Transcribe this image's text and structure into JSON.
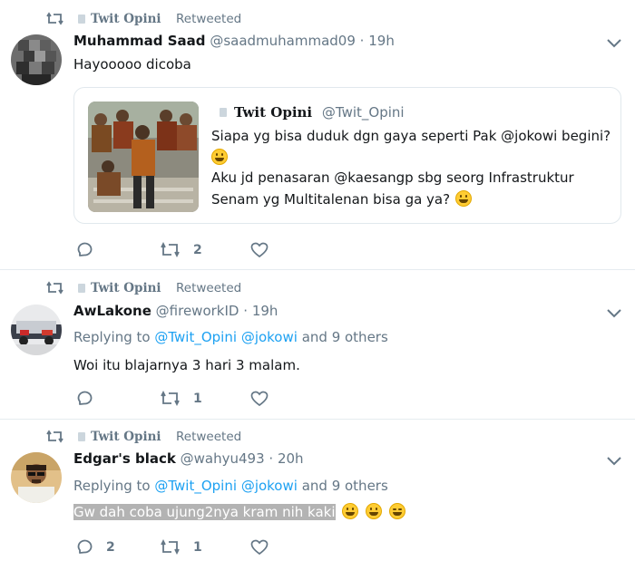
{
  "retweet_label": "Retweeted",
  "retweeter": "Twit Opini",
  "tweets": [
    {
      "name": "Muhammad Saad",
      "handle": "@saadmuhammad09",
      "sep": "·",
      "time": "19h",
      "text": "Hayooooo dicoba",
      "quote": {
        "name": "Twit Opini",
        "handle": "@Twit_Opini",
        "line1": "Siapa yg bisa duduk dgn gaya seperti Pak @jokowi begini?",
        "line2": "Aku jd penasaran @kaesangp sbg seorg Infrastruktur",
        "line3": "Senam yg Multitalenan bisa ga ya?"
      },
      "retweets": "2"
    },
    {
      "name": "AwLakone",
      "handle": "@fireworkID",
      "sep": "·",
      "time": "19h",
      "replying_prefix": "Replying to",
      "reply_user1": "@Twit_Opini",
      "reply_user2": "@jokowi",
      "reply_suffix": "and 9 others",
      "text": "Woi itu blajarnya 3 hari 3 malam.",
      "retweets": "1"
    },
    {
      "name": "Edgar's black",
      "handle": "@wahyu493",
      "sep": "·",
      "time": "20h",
      "replying_prefix": "Replying to",
      "reply_user1": "@Twit_Opini",
      "reply_user2": "@jokowi",
      "reply_suffix": "and 9 others",
      "text": "Gw dah coba ujung2nya kram nih kaki",
      "replies": "2",
      "retweets": "1"
    }
  ]
}
